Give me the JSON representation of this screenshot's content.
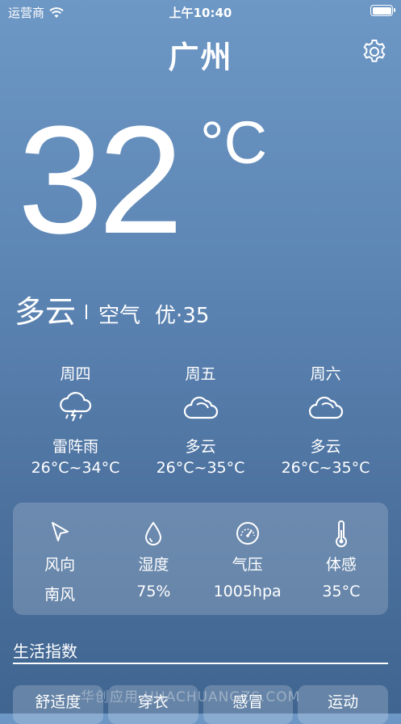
{
  "status_bar": {
    "carrier": "运营商",
    "time": "上午10:40"
  },
  "city": "广州",
  "current": {
    "temperature": "32",
    "unit": "°C",
    "condition": "多云",
    "air_label": "空气",
    "air_value": "优·35"
  },
  "forecast": [
    {
      "day": "周四",
      "icon": "thunder-rain-icon",
      "desc": "雷阵雨",
      "range": "26°C~34°C"
    },
    {
      "day": "周五",
      "icon": "cloud-icon",
      "desc": "多云",
      "range": "26°C~35°C"
    },
    {
      "day": "周六",
      "icon": "cloud-icon",
      "desc": "多云",
      "range": "26°C~35°C"
    }
  ],
  "details": [
    {
      "icon": "wind-direction-icon",
      "label": "风向",
      "value": "南风"
    },
    {
      "icon": "humidity-drop-icon",
      "label": "湿度",
      "value": "75%"
    },
    {
      "icon": "pressure-gauge-icon",
      "label": "气压",
      "value": "1005hpa"
    },
    {
      "icon": "thermometer-icon",
      "label": "体感",
      "value": "35°C"
    }
  ],
  "life_index": {
    "title": "生活指数",
    "items": [
      "舒适度",
      "穿衣",
      "感冒",
      "运动"
    ]
  },
  "watermark": "华创应用 HUACHUANGZS.COM"
}
